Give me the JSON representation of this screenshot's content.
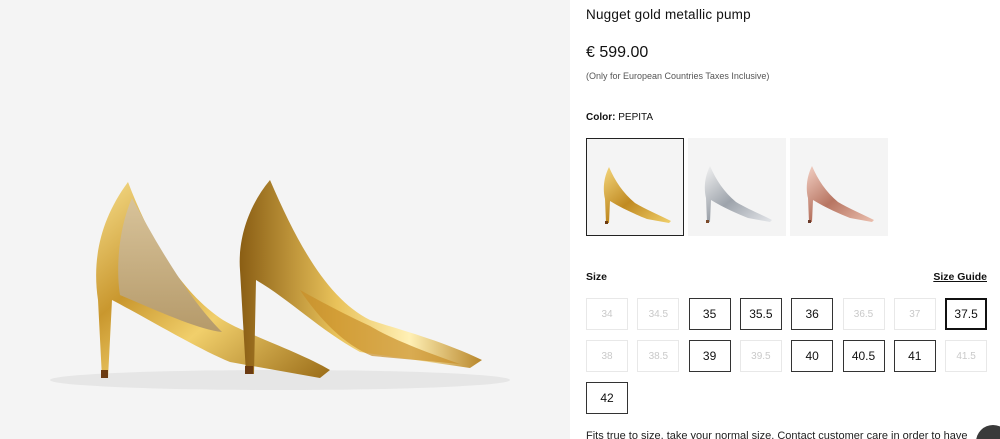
{
  "product": {
    "title": "Nugget gold metallic pump",
    "price": "€ 599.00",
    "tax_note": "(Only for European Countries Taxes Inclusive)",
    "color_label": "Color:",
    "color_value": "PEPITA"
  },
  "swatches": [
    {
      "name": "gold",
      "selected": true
    },
    {
      "name": "silver",
      "selected": false
    },
    {
      "name": "rose-gold",
      "selected": false
    }
  ],
  "size_section": {
    "label": "Size",
    "guide_label": "Size Guide"
  },
  "sizes": [
    {
      "label": "34",
      "available": false,
      "selected": false
    },
    {
      "label": "34.5",
      "available": false,
      "selected": false
    },
    {
      "label": "35",
      "available": true,
      "selected": false
    },
    {
      "label": "35.5",
      "available": true,
      "selected": false
    },
    {
      "label": "36",
      "available": true,
      "selected": false
    },
    {
      "label": "36.5",
      "available": false,
      "selected": false
    },
    {
      "label": "37",
      "available": false,
      "selected": false
    },
    {
      "label": "37.5",
      "available": true,
      "selected": true
    },
    {
      "label": "38",
      "available": false,
      "selected": false
    },
    {
      "label": "38.5",
      "available": false,
      "selected": false
    },
    {
      "label": "39",
      "available": true,
      "selected": false
    },
    {
      "label": "39.5",
      "available": false,
      "selected": false
    },
    {
      "label": "40",
      "available": true,
      "selected": false
    },
    {
      "label": "40.5",
      "available": true,
      "selected": false
    },
    {
      "label": "41",
      "available": true,
      "selected": false
    },
    {
      "label": "41.5",
      "available": false,
      "selected": false
    },
    {
      "label": "42",
      "available": true,
      "selected": false
    }
  ],
  "fit_note": "Fits true to size, take your normal size. Contact customer care in order to have"
}
